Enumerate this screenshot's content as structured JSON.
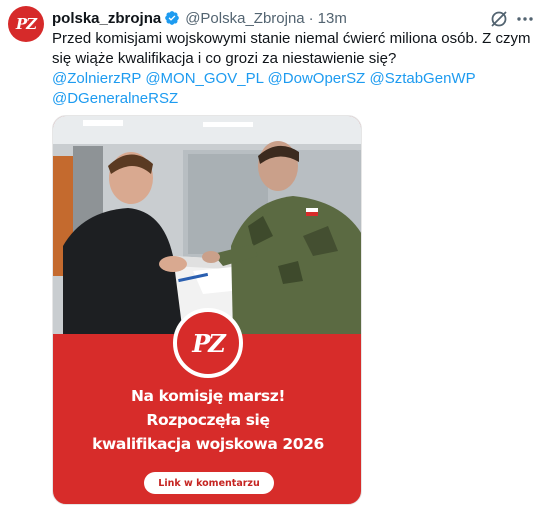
{
  "author": {
    "display_name": "polska_zbrojna",
    "handle": "@Polska_Zbrojna",
    "separator": "·",
    "time": "13m",
    "verified": true,
    "avatar_text": "PZ"
  },
  "tweet": {
    "text": "Przed komisjami wojskowymi stanie niemal ćwierć miliona osób. Z czym się wiąże kwalifikacja i co grozi za niestawienie się?",
    "mentions": [
      "@ZolnierzRP",
      "@MON_GOV_PL",
      "@DowOperSZ",
      "@SztabGenWP",
      "@DGeneralneRSZ"
    ]
  },
  "media": {
    "logo_text": "PZ",
    "headline": [
      "Na komisję marsz!",
      "Rozpoczęła się",
      "kwalifikacja wojskowa 2026"
    ],
    "cta_label": "Link w komentarzu"
  },
  "colors": {
    "brand_red": "#d72c2a",
    "link_blue": "#1d9bf0",
    "muted_gray": "#536471",
    "verified_blue": "#1d9bf0"
  },
  "icons": [
    "verified-badge-icon",
    "grok-icon",
    "more-options-icon"
  ]
}
